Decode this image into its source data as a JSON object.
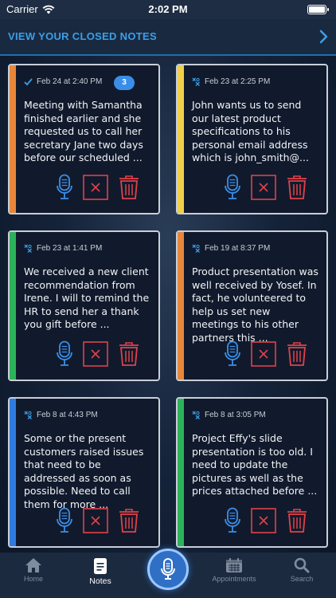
{
  "status_bar": {
    "carrier": "Carrier",
    "time": "2:02 PM"
  },
  "header": {
    "title": "VIEW YOUR CLOSED NOTES"
  },
  "notes": [
    {
      "status": "closed-check",
      "date": "Feb 24 at 2:40 PM",
      "badge": "3",
      "text": "Meeting with Samantha finished earlier and she requested us to call her secretary Jane two days before our scheduled ...",
      "stripe_color": "#e8873a"
    },
    {
      "status": "closed-cross",
      "date": "Feb 23 at 2:25 PM",
      "badge": "",
      "text": "John wants us to send our latest product specifications to his personal email address which is john_smith@...",
      "stripe_color": "#f1cf4a"
    },
    {
      "status": "closed-cross",
      "date": "Feb 23 at 1:41 PM",
      "badge": "",
      "text": "We received a new client recommendation from Irene. I will to remind the HR to send her a thank you gift before ...",
      "stripe_color": "#2cb25a"
    },
    {
      "status": "closed-cross",
      "date": "Feb 19 at 8:37 PM",
      "badge": "",
      "text": "Product presentation was well received by Yosef. In fact, he volunteered to help us set new meetings to his other partners this ...",
      "stripe_color": "#e8873a"
    },
    {
      "status": "closed-cross",
      "date": "Feb 8 at 4:43 PM",
      "badge": "",
      "text": "Some or the present customers raised issues that need to be addressed as soon as possible. Need to call them for more ...",
      "stripe_color": "#2f7be0"
    },
    {
      "status": "closed-cross",
      "date": "Feb 8 at 3:05 PM",
      "badge": "",
      "text": "Project Effy's slide presentation is too old. I need to update the pictures as well as the prices attached before ...",
      "stripe_color": "#2cb25a"
    }
  ],
  "tabs": [
    {
      "label": "Home",
      "icon": "home-icon",
      "active": false
    },
    {
      "label": "Notes",
      "icon": "notes-icon",
      "active": true
    },
    {
      "label": "Appointments",
      "icon": "calendar-icon",
      "active": false
    },
    {
      "label": "Search",
      "icon": "search-icon",
      "active": false
    }
  ],
  "colors": {
    "accent": "#3a9fe8",
    "mic_icon": "#3a8ee8",
    "delete_icon": "#e0414a",
    "badge": "#3a8ee8"
  }
}
